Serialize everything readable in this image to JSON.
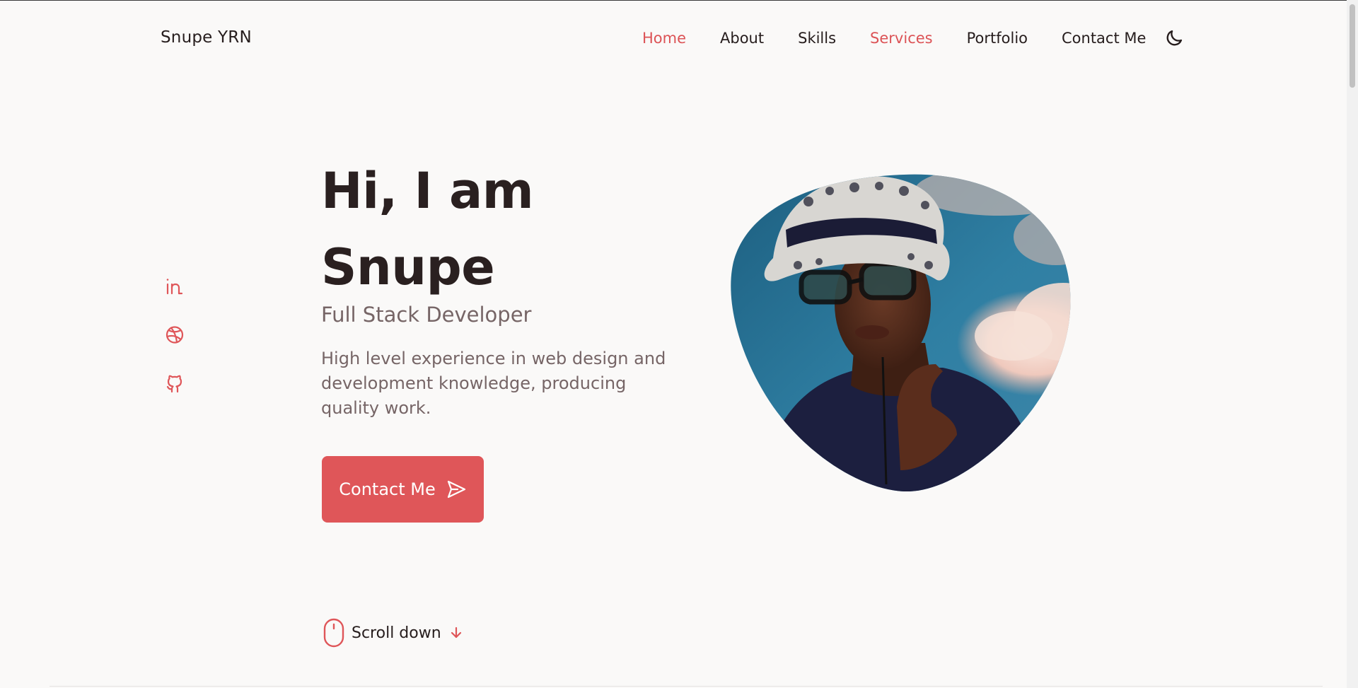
{
  "header": {
    "brand": "Snupe YRN",
    "nav": [
      {
        "label": "Home",
        "active": true
      },
      {
        "label": "About"
      },
      {
        "label": "Skills"
      },
      {
        "label": "Services",
        "active": true
      },
      {
        "label": "Portfolio"
      },
      {
        "label": "Contact Me"
      }
    ],
    "theme_icon": "moon-icon"
  },
  "social": [
    {
      "icon": "linkedin-icon"
    },
    {
      "icon": "dribbble-icon"
    },
    {
      "icon": "github-icon"
    }
  ],
  "hero": {
    "title_line1": "Hi, I am",
    "title_line2": "Snupe",
    "subtitle": "Full Stack Developer",
    "description": "High level experience in web design and development knowledge, producing quality work.",
    "cta_label": "Contact Me",
    "cta_icon": "send-icon"
  },
  "scroll": {
    "label": "Scroll down",
    "icon": "mouse-icon",
    "arrow_icon": "arrow-down-icon"
  },
  "colors": {
    "accent": "#df5659",
    "text_dark": "#261d1d",
    "text_muted": "#766566",
    "background": "#faf9f8"
  }
}
